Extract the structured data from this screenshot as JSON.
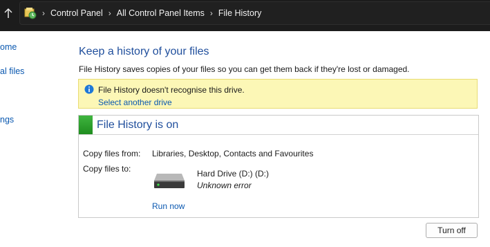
{
  "breadcrumb": [
    "Control Panel",
    "All Control Panel Items",
    "File History"
  ],
  "sidebar": {
    "items": [
      {
        "label": "ome"
      },
      {
        "label": "al files"
      },
      {
        "label": "ngs"
      }
    ]
  },
  "main": {
    "title": "Keep a history of your files",
    "description": "File History saves copies of your files so you can get them back if they're lost or damaged."
  },
  "warning": {
    "message": "File History doesn't recognise this drive.",
    "link": "Select another drive"
  },
  "status_panel": {
    "title": "File History is on",
    "status_color": "#2ea82e",
    "copy_from_label": "Copy files from:",
    "copy_from_value": "Libraries, Desktop, Contacts and Favourites",
    "copy_to_label": "Copy files to:",
    "drive_icon": "hard-drive-icon",
    "drive_name": "Hard Drive (D:) (D:)",
    "drive_status": "Unknown error",
    "run_now": "Run now"
  },
  "buttons": {
    "turn_off": "Turn off"
  },
  "colors": {
    "link": "#0a58b0",
    "heading": "#1f4e9c",
    "warning_bg": "#fcf7b6"
  }
}
